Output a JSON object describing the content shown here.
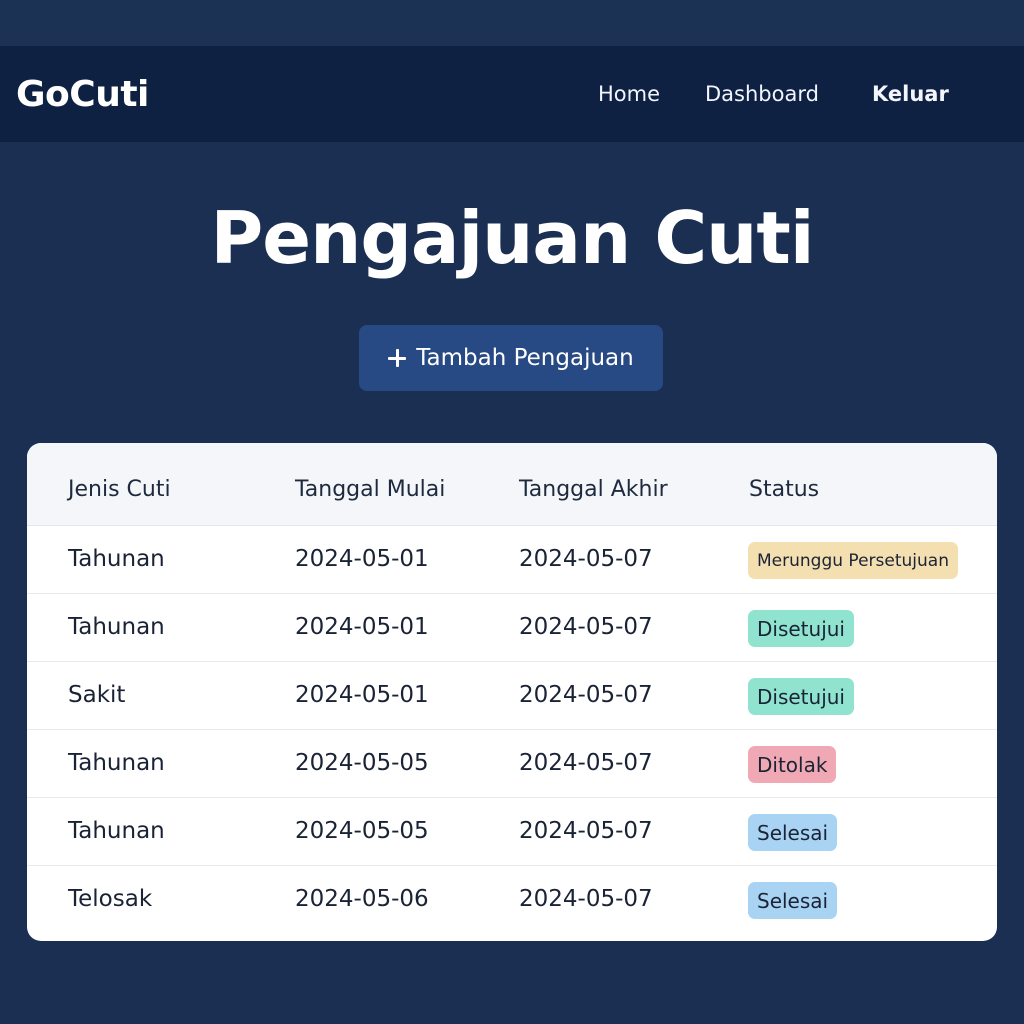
{
  "app": {
    "brand": "GoCuti"
  },
  "nav": {
    "home": "Home",
    "dashboard": "Dashboard",
    "logout": "Keluar"
  },
  "page": {
    "title": "Pengajuan Cuti",
    "add_button": "Tambah Pengajuan"
  },
  "table": {
    "headers": [
      "Jenis Cuti",
      "Tanggal Mulai",
      "Tanggal Akhir",
      "Status"
    ],
    "rows": [
      {
        "type": "Tahunan",
        "start": "2024-05-01",
        "end": "2024-05-07",
        "status": "Merunggu Persetujuan",
        "status_color": "#f3dfb0"
      },
      {
        "type": "Tahunan",
        "start": "2024-05-01",
        "end": "2024-05-07",
        "status": "Disetujui",
        "status_color": "#8fe3cf"
      },
      {
        "type": "Sakit",
        "start": "2024-05-01",
        "end": "2024-05-07",
        "status": "Disetujui",
        "status_color": "#8fe3cf"
      },
      {
        "type": "Tahunan",
        "start": "2024-05-05",
        "end": "2024-05-07",
        "status": "Ditolak",
        "status_color": "#f0a9b4"
      },
      {
        "type": "Tahunan",
        "start": "2024-05-05",
        "end": "2024-05-07",
        "status": "Selesai",
        "status_color": "#a9d3f3"
      },
      {
        "type": "Telosak",
        "start": "2024-05-06",
        "end": "2024-05-07",
        "status": "Selesai",
        "status_color": "#a9d3f3"
      }
    ]
  },
  "colors": {
    "background": "#1a2f52",
    "navbar": "#0e2143",
    "button": "#274a84"
  },
  "icons": {
    "add": "plus-icon"
  }
}
